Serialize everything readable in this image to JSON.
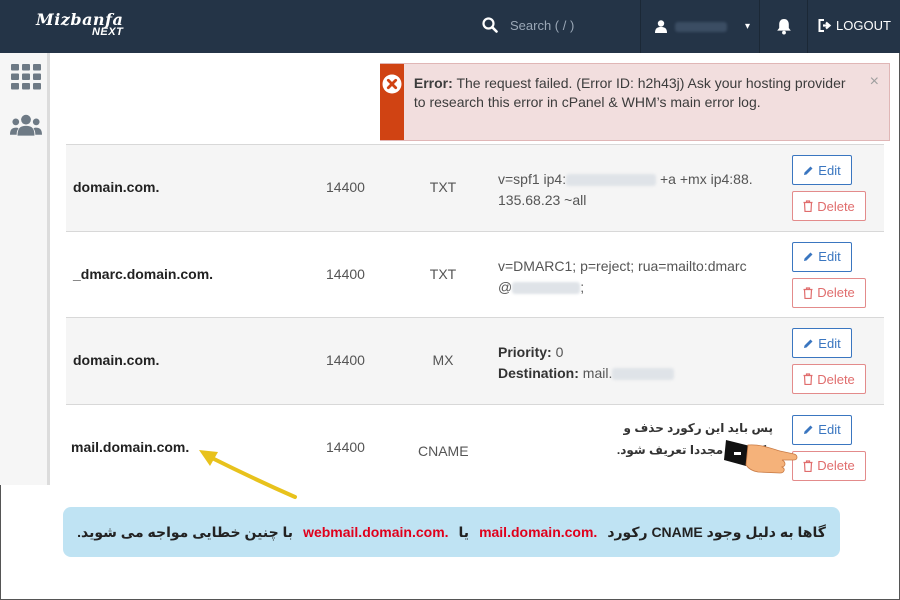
{
  "brand": {
    "line1": "Mizbanfa",
    "line2": "NEXT"
  },
  "search": {
    "placeholder": "Search ( / )",
    "icon": "search-icon"
  },
  "user_menu": {
    "icon": "user-icon",
    "caret": "▾"
  },
  "notifications": {
    "icon": "bell-icon"
  },
  "logout": {
    "label": "LOGOUT",
    "icon": "logout-icon"
  },
  "rail": [
    {
      "icon": "grid-icon"
    },
    {
      "icon": "users-icon"
    }
  ],
  "alert": {
    "title": "Error:",
    "message": "The request failed. (Error ID: h2h43j) Ask your hosting provider to research this error in cPanel & WHM’s main error log.",
    "close": "×",
    "color": "#d04313"
  },
  "records": [
    {
      "name": "domain.com.",
      "ttl": "14400",
      "type": "TXT",
      "line1a": "v=spf1 ip4:",
      "line1b": "+a +mx ip4:88.",
      "line2": "135.68.23 ~all",
      "edit": "Edit",
      "delete": "Delete"
    },
    {
      "name": "_dmarc.domain.com.",
      "ttl": "14400",
      "type": "TXT",
      "line1": "v=DMARC1; p=reject; rua=mailto:dmarc",
      "line2a": "@",
      "line2b": ";",
      "edit": "Edit",
      "delete": "Delete"
    },
    {
      "name": "domain.com.",
      "ttl": "14400",
      "type": "MX",
      "priority_label": "Priority:",
      "priority": "0",
      "dest_label": "Destination:",
      "dest": "mail.",
      "edit": "Edit",
      "delete": "Delete"
    },
    {
      "name": "mail.domain.com.",
      "ttl": "14400",
      "type": "CNAME",
      "edit": "Edit",
      "delete": "Delete"
    }
  ],
  "annotation": {
    "line1": "پس باید این رکورد حذف و",
    "line2": "رکورد A مجددا تعریف شود."
  },
  "caption": {
    "part1": "گاها به دلیل وجود CNAME رکورد",
    "term1": "mail.domain.com.",
    "part2": "یا",
    "term2": "webmail.domain.com.",
    "part3": "با چنین خطایی مواجه می شوید."
  },
  "colors": {
    "topbar": "#243447",
    "edit": "#3a76c0",
    "delete": "#e06d6d",
    "caption_bg": "#bfe3f3",
    "highlight": "#e0001b",
    "arrow": "#e8c21c"
  }
}
